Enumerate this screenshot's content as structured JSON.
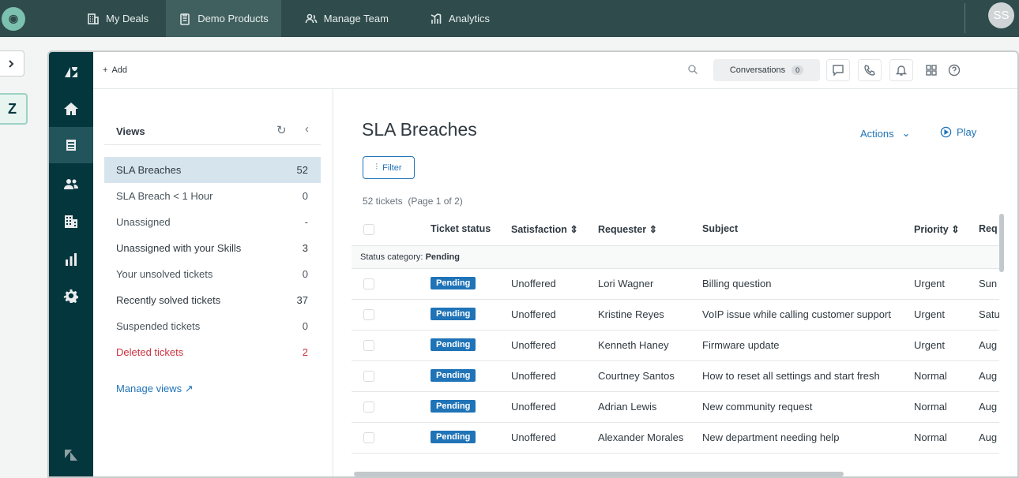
{
  "topbar": {
    "nav": [
      {
        "label": "My Deals",
        "icon": "building-icon"
      },
      {
        "label": "Demo Products",
        "icon": "clipboard-icon"
      },
      {
        "label": "Manage Team",
        "icon": "team-icon"
      },
      {
        "label": "Analytics",
        "icon": "analytics-icon"
      }
    ],
    "avatar_initials": "SS"
  },
  "header": {
    "add_label": "Add",
    "conversations_label": "Conversations",
    "conversations_count": "0"
  },
  "views": {
    "title": "Views",
    "items": [
      {
        "label": "SLA Breaches",
        "count": "52"
      },
      {
        "label": "SLA Breach < 1 Hour",
        "count": "0"
      },
      {
        "label": "Unassigned",
        "count": "-"
      },
      {
        "label": "Unassigned with your Skills",
        "count": "3"
      },
      {
        "label": "Your unsolved tickets",
        "count": "0"
      },
      {
        "label": "Recently solved tickets",
        "count": "37"
      },
      {
        "label": "Suspended tickets",
        "count": "0"
      },
      {
        "label": "Deleted tickets",
        "count": "2"
      }
    ],
    "manage_label": "Manage views"
  },
  "content": {
    "title": "SLA Breaches",
    "actions_label": "Actions",
    "play_label": "Play",
    "filter_label": "Filter",
    "ticket_count": "52 tickets",
    "page_info": "(Page 1 of 2)",
    "columns": {
      "status": "Ticket status",
      "satisfaction": "Satisfaction",
      "requester": "Requester",
      "subject": "Subject",
      "priority": "Priority",
      "requested": "Req"
    },
    "category_prefix": "Status category:",
    "category_value": "Pending",
    "rows": [
      {
        "status": "Pending",
        "satisfaction": "Unoffered",
        "requester": "Lori Wagner",
        "subject": "Billing question",
        "priority": "Urgent",
        "requested": "Sun"
      },
      {
        "status": "Pending",
        "satisfaction": "Unoffered",
        "requester": "Kristine Reyes",
        "subject": "VoIP issue while calling customer support",
        "priority": "Urgent",
        "requested": "Satu"
      },
      {
        "status": "Pending",
        "satisfaction": "Unoffered",
        "requester": "Kenneth Haney",
        "subject": "Firmware update",
        "priority": "Urgent",
        "requested": "Aug"
      },
      {
        "status": "Pending",
        "satisfaction": "Unoffered",
        "requester": "Courtney Santos",
        "subject": "How to reset all settings and start fresh",
        "priority": "Normal",
        "requested": "Aug"
      },
      {
        "status": "Pending",
        "satisfaction": "Unoffered",
        "requester": "Adrian Lewis",
        "subject": "New community request",
        "priority": "Normal",
        "requested": "Aug"
      },
      {
        "status": "Pending",
        "satisfaction": "Unoffered",
        "requester": "Alexander Morales",
        "subject": "New department needing help",
        "priority": "Normal",
        "requested": "Aug"
      }
    ]
  },
  "colors": {
    "topbar": "#2f4b4b",
    "rail": "#03363d",
    "accent": "#1f73b7",
    "active_view": "#d6e4ee",
    "deleted": "#cc3340"
  }
}
